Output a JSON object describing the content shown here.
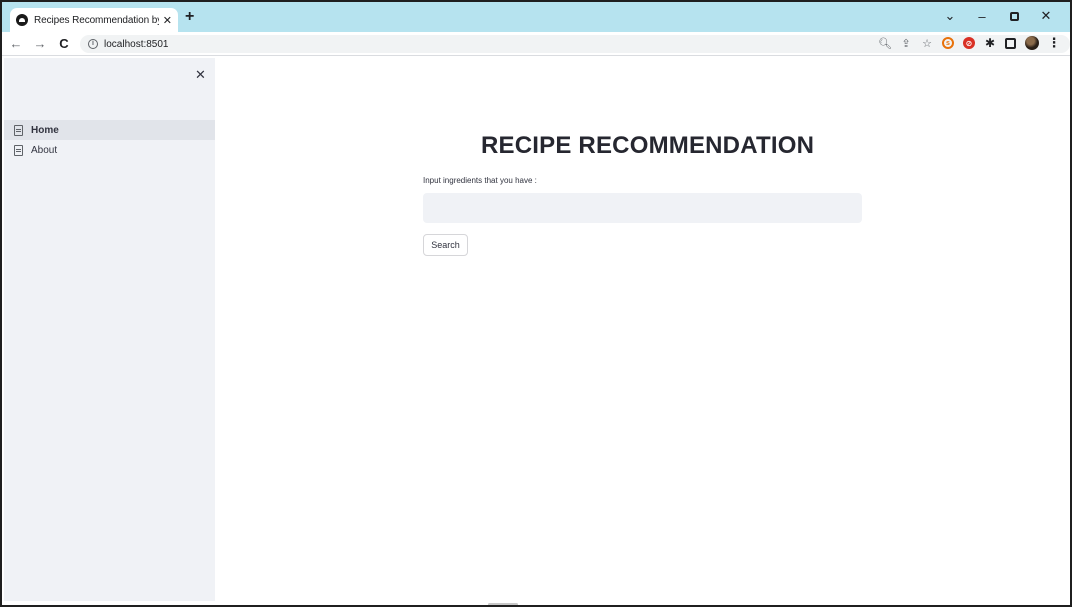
{
  "browser": {
    "tab_title": "Recipes Recommendation by Epi",
    "tab_close": "✕",
    "new_tab": "+",
    "url": "localhost:8501",
    "nav": {
      "back": "←",
      "forward": "→",
      "reload": "C"
    },
    "window_controls": {
      "collapse": "⌄",
      "minimize": "–",
      "close": "✕"
    },
    "toolbar_icons": [
      "zoom-icon",
      "share-icon",
      "star-icon",
      "extension-orange-icon",
      "extension-red-icon",
      "puzzle-icon",
      "side-panel-icon",
      "profile-avatar",
      "menu-icon"
    ]
  },
  "sidebar": {
    "close": "✕",
    "items": [
      {
        "label": "Home",
        "active": true
      },
      {
        "label": "About",
        "active": false
      }
    ]
  },
  "main": {
    "title": "RECIPE RECOMMENDATION",
    "input_label": "Input ingredients that you have :",
    "input_value": "",
    "input_placeholder": "",
    "search_label": "Search"
  },
  "colors": {
    "tabstrip": "#b6e3ef",
    "sidebar_bg": "#f0f2f6",
    "input_bg": "#f0f2f6",
    "text": "#31333f"
  }
}
